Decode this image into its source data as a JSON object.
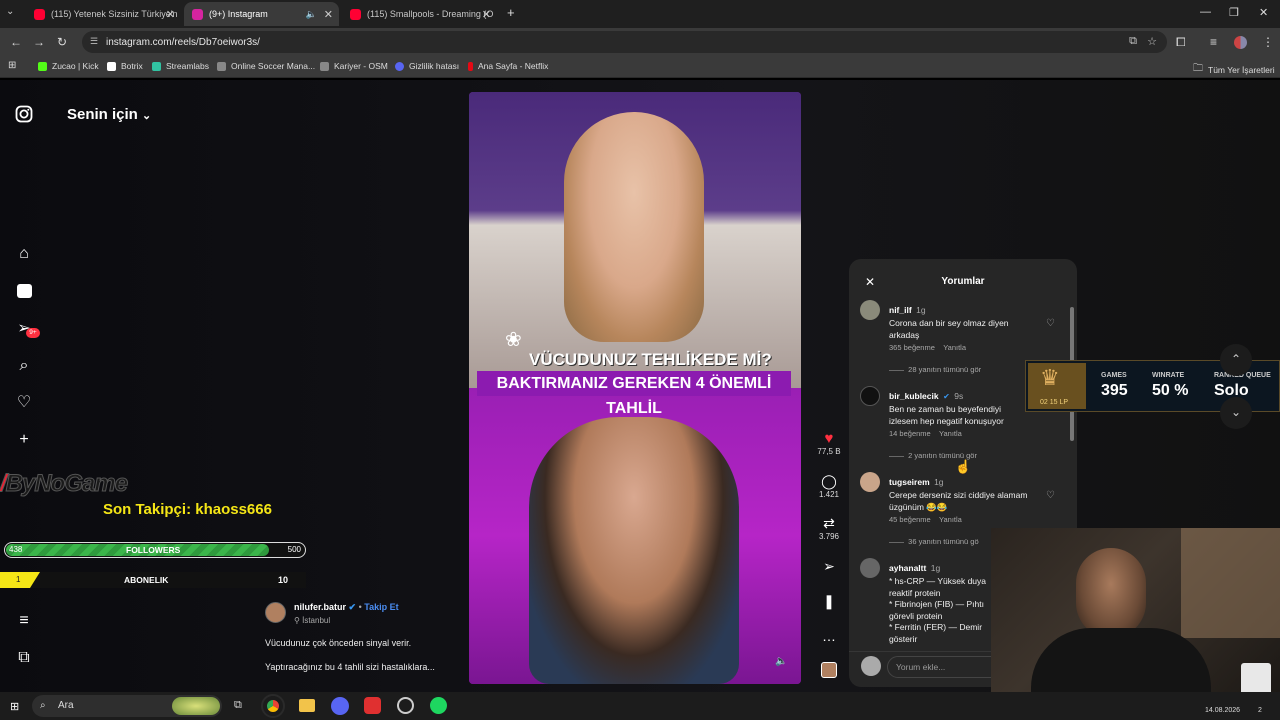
{
  "tabs": [
    {
      "label": "(115) Yetenek Sizsiniz Türkiye'n",
      "color": "#ff0033"
    },
    {
      "label": "(9+) Instagram",
      "color": "#d6249f"
    },
    {
      "label": "(115) Smallpools - Dreaming (O",
      "color": "#ff0033"
    }
  ],
  "url": "instagram.com/reels/Db7oeiwor3s/",
  "bookmarks": [
    {
      "label": "Zucao | Kick",
      "color": "#53fc18"
    },
    {
      "label": "Botrix",
      "color": "#ffffff"
    },
    {
      "label": "Streamlabs",
      "color": "#31c3a2"
    },
    {
      "label": "Online Soccer Mana...",
      "color": "#888888"
    },
    {
      "label": "Kariyer - OSM",
      "color": "#888888"
    },
    {
      "label": "Gizlilik hatası",
      "color": "#5865f2"
    },
    {
      "label": "Ana Sayfa - Netflix",
      "color": "#e50914"
    }
  ],
  "bookmarks_all": "Tüm Yer İşaretleri",
  "feed_title": "Senin için",
  "nav_badge": "9+",
  "overlay": {
    "brand": "ByNoGame",
    "last_follower": "Son Takipçi: khaoss666",
    "followers_current": "438",
    "followers_label": "FOLLOWERS",
    "followers_goal": "500",
    "followers_progress": 0.876,
    "subs_current": "1",
    "subs_label": "ABONELIK",
    "subs_goal": "10",
    "subs_progress": 0.1
  },
  "video": {
    "headline1": "VÜCUDUNUZ TEHLİKEDE Mİ?",
    "headline2": "BAKTIRMANIZ GEREKEN 4 ÖNEMLİ TAHLİL"
  },
  "post": {
    "author": "nilufer.batur",
    "follow": "Takip Et",
    "location": "İstanbul",
    "caption1": "Vücudunuz çok önceden sinyal verir.",
    "caption2": "Yaptıracağınız bu 4 tahlil sizi hastalıklara..."
  },
  "actions": {
    "likes": "77,5 B",
    "comments": "1.421",
    "shares": "3.796"
  },
  "comments": {
    "title": "Yorumlar",
    "placeholder": "Yorum ekle...",
    "items": [
      {
        "user": "nif_ilf",
        "time": "1g",
        "text": [
          "Corona dan bir sey olmaz diyen",
          "arkadaş"
        ],
        "likes": "365 beğenme",
        "reply": "Yanıtla",
        "more": "28 yanıtın tümünü gör"
      },
      {
        "user": "bir_kublecik",
        "time": "9s",
        "text": [
          "Ben ne zaman bu beyefendiyi",
          "izlesem hep negatif konuşuyor"
        ],
        "likes": "14 beğenme",
        "reply": "Yanıtla",
        "more": "2 yanıtın tümünü gör"
      },
      {
        "user": "tugseirem",
        "time": "1g",
        "text": [
          "Cerepe derseniz sizi ciddiye alamam",
          "üzgünüm 😂😂"
        ],
        "likes": "45 beğenme",
        "reply": "Yanıtla",
        "more": "36 yanıtın tümünü gö"
      },
      {
        "user": "ayhanaltt",
        "time": "1g",
        "text": [
          "* hs-CRP — Yüksek duya",
          "reaktif protein",
          "* Fibrinojen (FIB) — Pıhtı",
          "görevli protein",
          "* Ferritin (FER) — Demir",
          "gösterir"
        ]
      }
    ]
  },
  "lol": {
    "lp": "02 15 LP",
    "games_label": "GAMES",
    "games": "395",
    "winrate_label": "WINRATE",
    "winrate": "50 %",
    "queue_label": "RANKED QUEUE",
    "queue": "Solo"
  },
  "taskbar": {
    "search": "Ara",
    "date": "14.08.2026",
    "notif": "2"
  }
}
